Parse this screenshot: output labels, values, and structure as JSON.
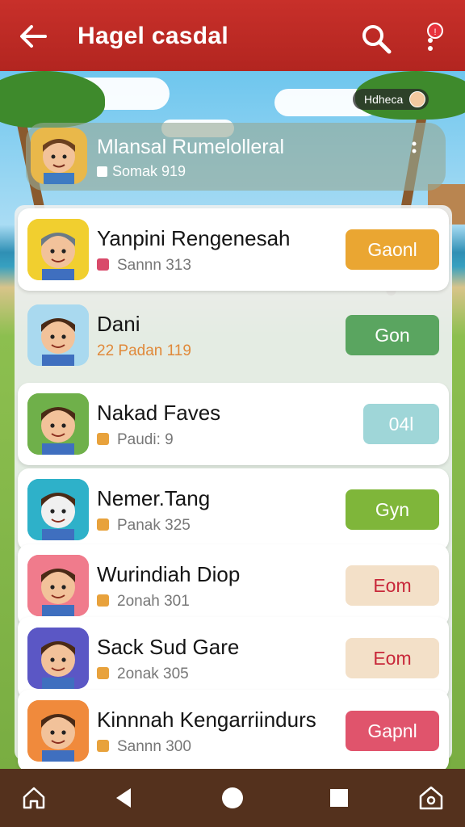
{
  "header": {
    "title": "Hagel casdal",
    "notification_count": "!"
  },
  "chip": {
    "label": "Hdheca"
  },
  "profile": {
    "name": "Mlansal Rumelolleral",
    "sub": "Somak 919"
  },
  "rows": [
    {
      "name": "Yanpini Rengenesah",
      "sub": "Sannn 313",
      "tag_color": "#d94a6a",
      "button": "Gaonl",
      "button_color": "#eaa632",
      "avatar_bg": "#f1cf2f",
      "plain": false
    },
    {
      "name": "Dani",
      "sub": "22 Padan 119",
      "tag_color": "",
      "button": "Gon",
      "button_color": "#5aa560",
      "avatar_bg": "#a9d9ef",
      "plain": true
    },
    {
      "name": "Nakad Faves",
      "sub": "Paudi: 9",
      "tag_color": "#e8a23c",
      "button": "04l",
      "button_color": "#9fd6d8",
      "avatar_bg": "#6fb04a",
      "plain": false
    },
    {
      "name": "Nemer.Tang",
      "sub": "Panak 325",
      "tag_color": "#e8a23c",
      "button": "Gyn",
      "button_color": "#7fb63a",
      "avatar_bg": "#2eb1c9",
      "plain": false
    },
    {
      "name": "Wurindiah Diop",
      "sub": "2onah 301",
      "tag_color": "#e8a23c",
      "button": "Eom",
      "button_color": "#f3e0c8",
      "avatar_bg": "#f07b8c",
      "plain": false
    },
    {
      "name": "Sack Sud Gare",
      "sub": "2onak 305",
      "tag_color": "#e8a23c",
      "button": "Eom",
      "button_color": "#f3e0c8",
      "avatar_bg": "#5b57c5",
      "plain": false
    },
    {
      "name": "Kinnnah Kengarriindurs",
      "sub": "Sannn 300",
      "tag_color": "#e8a23c",
      "button": "Gapnl",
      "button_color": "#e0546c",
      "avatar_bg": "#f08a3c",
      "plain": false
    }
  ],
  "nav": [
    "home-icon",
    "back-triangle-icon",
    "home-circle-icon",
    "recents-square-icon",
    "camera-home-icon"
  ]
}
